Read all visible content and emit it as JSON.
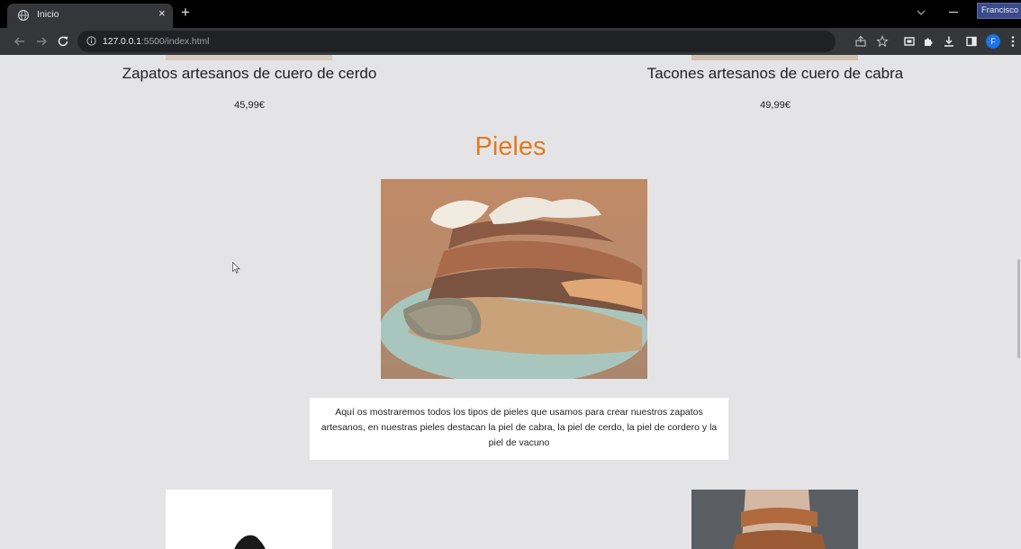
{
  "browser": {
    "tab_title": "Inicio",
    "tab_close": "×",
    "new_tab": "+",
    "profile_name": "Francisco",
    "avatar_letter": "F",
    "url_host": "127.0.0.1",
    "url_rest": ":5500/index.html"
  },
  "products_top": [
    {
      "title": "Zapatos artesanos de cuero de cerdo",
      "price": "45,99€"
    },
    {
      "title": "Tacones artesanos de cuero de cabra",
      "price": "49,99€"
    }
  ],
  "section": {
    "title": "Pieles",
    "description": "Aquí os mostraremos todos los tipos de pieles que usamos para crear nuestros zapatos artesanos, en nuestras pieles destacan la piel de cabra, la piel de cerdo, la piel de cordero y la piel de vacuno"
  },
  "colors": {
    "accent": "#e07b1f",
    "page_bg": "#e4e4e6",
    "toolbar_bg": "#35363a",
    "tabstrip_bg": "#000000"
  }
}
